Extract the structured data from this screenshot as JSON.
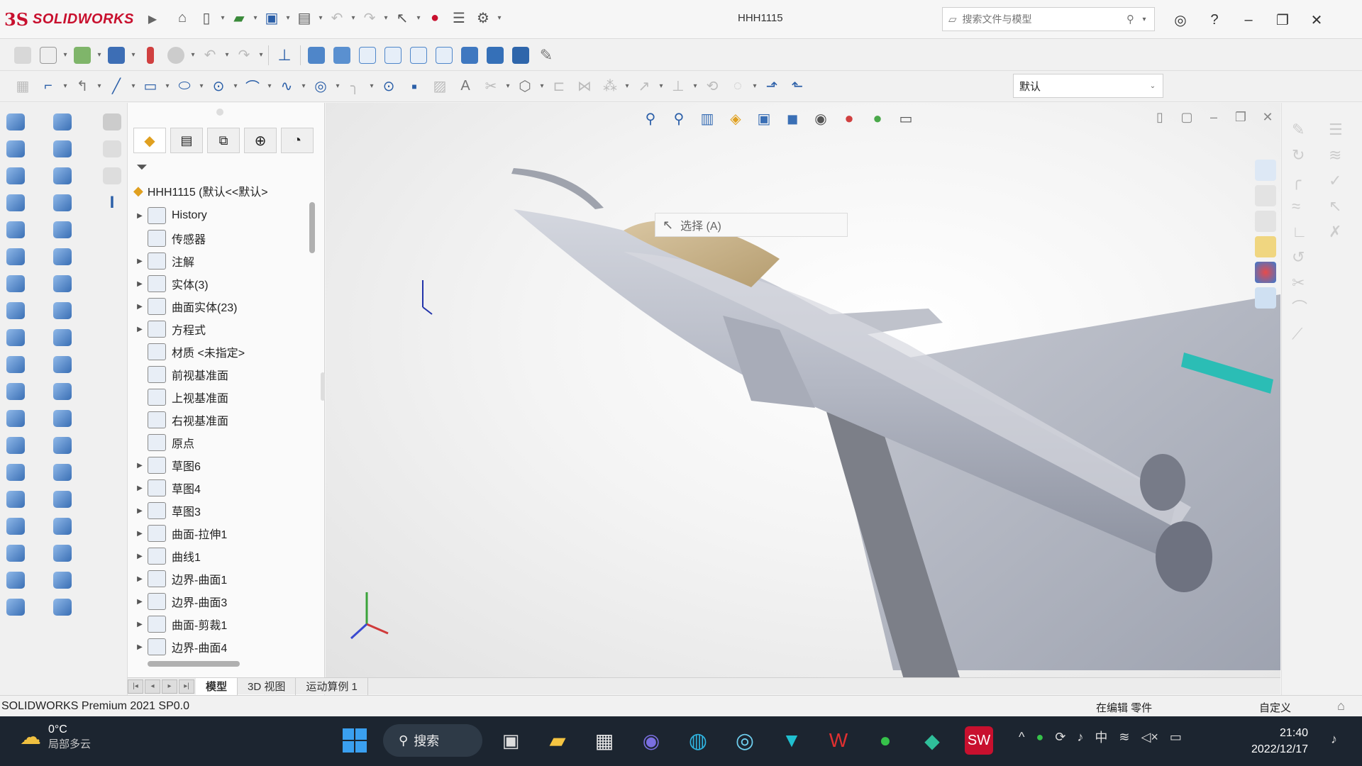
{
  "app": {
    "brand_prefix": "3S",
    "brand": "SOLIDWORKS",
    "doc_title": "HHH1115",
    "search_placeholder": "搜索文件与模型"
  },
  "config_select": {
    "value": "默认"
  },
  "feature_tree": {
    "root": "HHH1115 (默认<<默认>",
    "items": [
      {
        "label": "History",
        "expandable": true
      },
      {
        "label": "传感器",
        "expandable": false
      },
      {
        "label": "注解",
        "expandable": true
      },
      {
        "label": "实体(3)",
        "expandable": true
      },
      {
        "label": "曲面实体(23)",
        "expandable": true
      },
      {
        "label": "方程式",
        "expandable": true
      },
      {
        "label": "材质 <未指定>",
        "expandable": false
      },
      {
        "label": "前视基准面",
        "expandable": false
      },
      {
        "label": "上视基准面",
        "expandable": false
      },
      {
        "label": "右视基准面",
        "expandable": false
      },
      {
        "label": "原点",
        "expandable": false
      },
      {
        "label": "草图6",
        "expandable": true
      },
      {
        "label": "草图4",
        "expandable": true
      },
      {
        "label": "草图3",
        "expandable": true
      },
      {
        "label": "曲面-拉伸1",
        "expandable": true
      },
      {
        "label": "曲线1",
        "expandable": true
      },
      {
        "label": "边界-曲面1",
        "expandable": true
      },
      {
        "label": "边界-曲面3",
        "expandable": true
      },
      {
        "label": "曲面-剪裁1",
        "expandable": true
      },
      {
        "label": "边界-曲面4",
        "expandable": true
      }
    ]
  },
  "viewport": {
    "tooltip": "选择 (A)"
  },
  "bottom_tabs": [
    {
      "label": "模型",
      "active": true
    },
    {
      "label": "3D 视图",
      "active": false
    },
    {
      "label": "运动算例 1",
      "active": false
    }
  ],
  "status": {
    "product": "SOLIDWORKS Premium 2021 SP0.0",
    "mode": "在编辑 零件",
    "custom": "自定义"
  },
  "taskbar": {
    "temperature": "0°C",
    "weather": "局部多云",
    "search": "搜索",
    "time": "21:40",
    "date": "2022/12/17",
    "ime": "中"
  },
  "colors": {
    "brand_red": "#c8102e",
    "taskbar_bg": "#1c2530",
    "aircraft": "#b9bcc6",
    "canopy": "#c7b08a",
    "accent_teal": "#2bbdb5"
  }
}
